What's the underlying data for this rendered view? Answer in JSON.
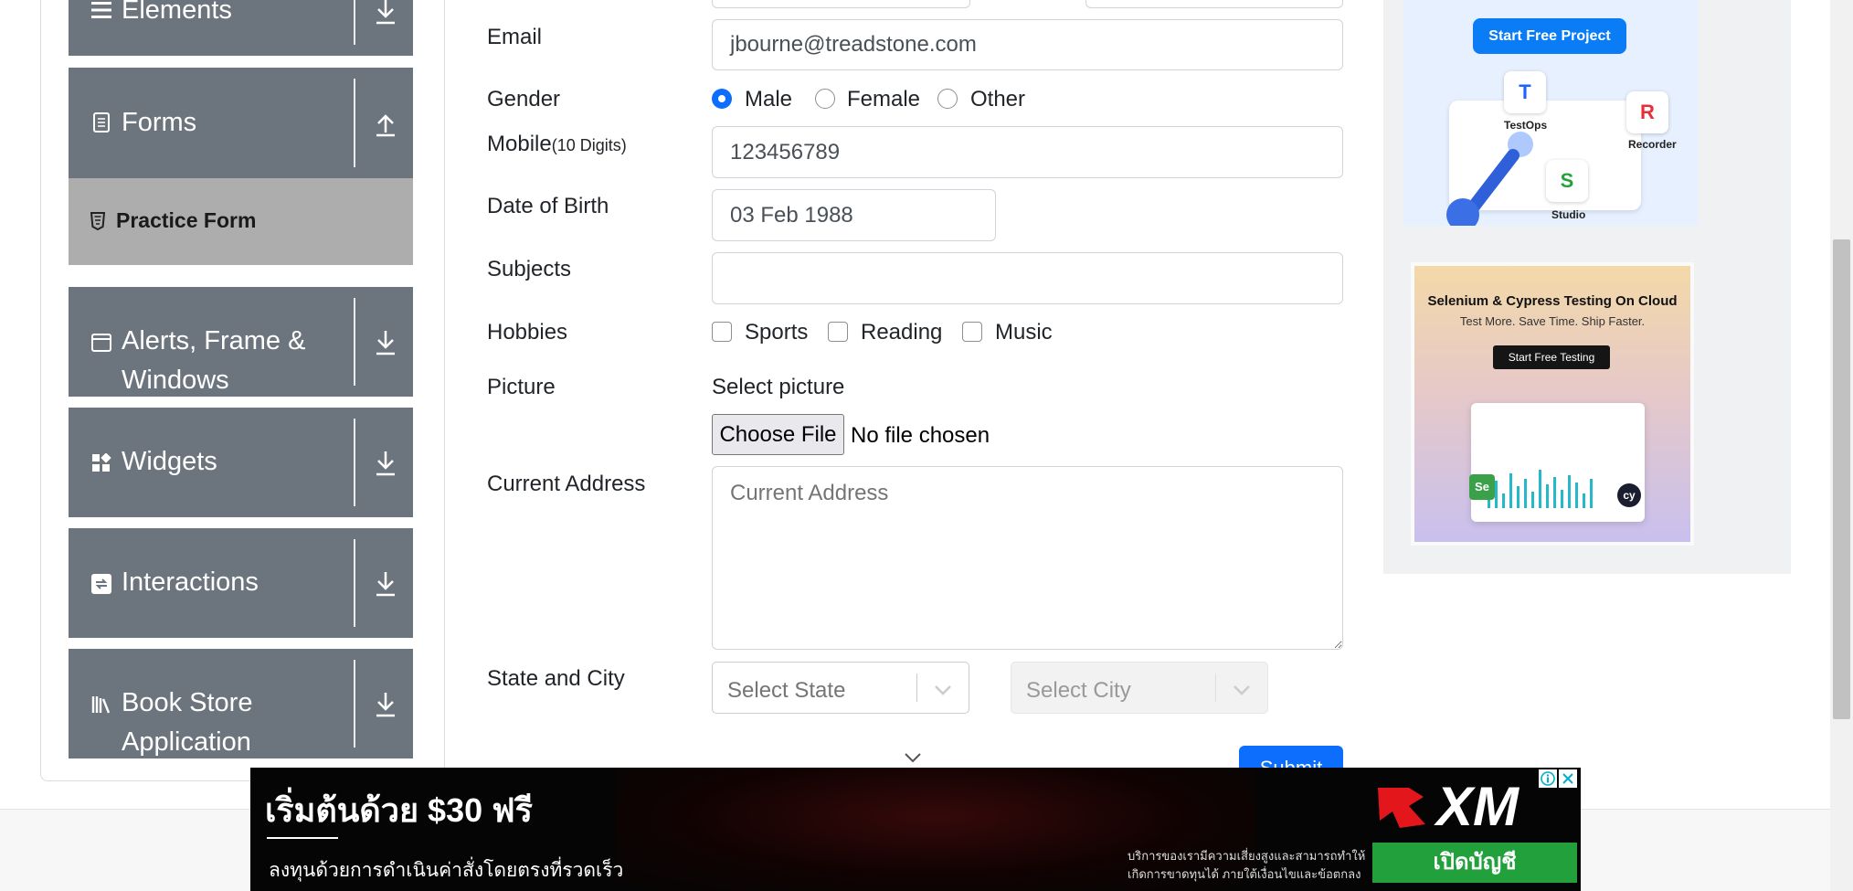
{
  "sidebar": {
    "groups": [
      {
        "label": "Elements",
        "icon": "hamburger-icon",
        "arrow": "download-arrow-icon"
      },
      {
        "label": "Forms",
        "icon": "document-icon",
        "arrow": "upload-arrow-icon"
      },
      {
        "label_line1": "Alerts, Frame &",
        "label_line2": "Windows",
        "icon": "window-icon",
        "arrow": "download-arrow-icon"
      },
      {
        "label": "Widgets",
        "icon": "widgets-icon",
        "arrow": "download-arrow-icon"
      },
      {
        "label": "Interactions",
        "icon": "interactions-icon",
        "arrow": "download-arrow-icon"
      },
      {
        "label_line1": "Book Store",
        "label_line2": "Application",
        "icon": "books-icon",
        "arrow": "download-arrow-icon"
      }
    ],
    "active_item": {
      "label": "Practice Form",
      "icon": "html5-icon"
    }
  },
  "form": {
    "email": {
      "label": "Email",
      "value": "jbourne@treadstone.com"
    },
    "gender": {
      "label": "Gender",
      "options": [
        "Male",
        "Female",
        "Other"
      ],
      "selected": "Male"
    },
    "mobile": {
      "label": "Mobile",
      "hint": "(10 Digits)",
      "value": "123456789"
    },
    "dob": {
      "label": "Date of Birth",
      "value": "03 Feb 1988"
    },
    "subjects": {
      "label": "Subjects",
      "value": ""
    },
    "hobbies": {
      "label": "Hobbies",
      "options": [
        "Sports",
        "Reading",
        "Music"
      ],
      "checked": []
    },
    "picture": {
      "label": "Picture",
      "prompt": "Select picture",
      "button": "Choose File",
      "status": "No file chosen"
    },
    "address": {
      "label": "Current Address",
      "placeholder": "Current Address"
    },
    "state_city": {
      "label": "State and City",
      "state_placeholder": "Select State",
      "city_placeholder": "Select City"
    },
    "submit_label": "Submit"
  },
  "ads": {
    "ad1": {
      "button": "Start Free Project",
      "products": [
        "TestOps",
        "Recorder",
        "Studio"
      ]
    },
    "ad2": {
      "title": "Selenium & Cypress Testing On Cloud",
      "subtitle": "Test More. Save Time. Ship Faster.",
      "button": "Start Free Testing"
    }
  },
  "banner": {
    "headline": "เริ่มต้นด้วย $30 ฟรี",
    "subline": "ลงทุนด้วยการดำเนินค่าสั่งโดยตรงที่รวดเร็ว",
    "brand": "XM",
    "fineprint_1": "บริการของเรามีความเสี่ยงสูงและสามารถทำให้",
    "fineprint_2": "เกิดการขาดทุนได้ ภายใต้เงื่อนไขและข้อตกลง",
    "cta": "เปิดบัญชี",
    "accent": "#22a03c"
  },
  "colors": {
    "primary": "#0d6efd",
    "sidebar": "#6c757d",
    "active_item": "#adadad"
  }
}
